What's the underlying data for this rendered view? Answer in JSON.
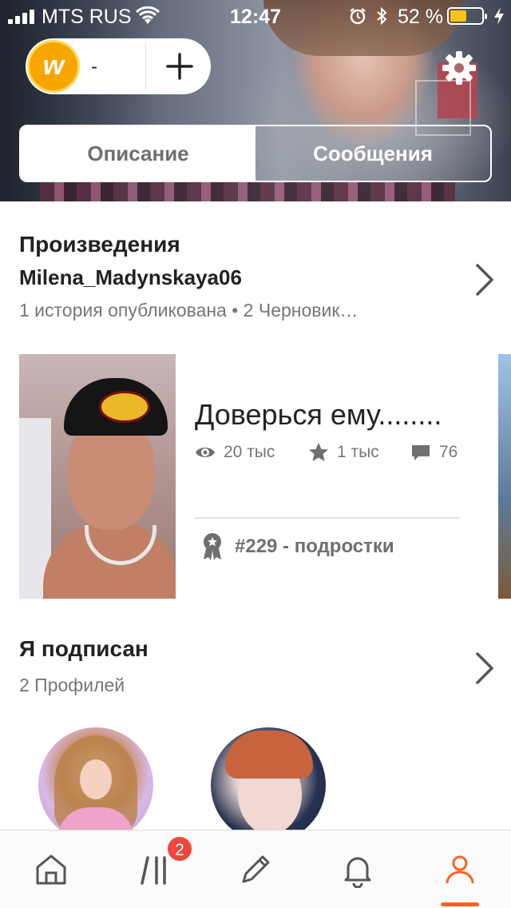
{
  "status_bar": {
    "carrier": "MTS RUS",
    "time": "12:47",
    "battery_percent_text": "52 %",
    "battery_level": 0.52
  },
  "header": {
    "coin_count": "-",
    "coin_letter": "w",
    "tabs": [
      {
        "label": "Описание",
        "active": true
      },
      {
        "label": "Сообщения",
        "active": false
      }
    ]
  },
  "works": {
    "title": "Произведения",
    "username": "Milena_Madynskaya06",
    "summary": "1 история опубликована • 2 Черновик…",
    "story": {
      "title": "Доверься ему........",
      "reads": "20 тыс",
      "votes": "1 тыс",
      "comments": "76",
      "rank_number": "#229",
      "rank_sep": " - ",
      "rank_tag": "подростки"
    }
  },
  "following": {
    "title": "Я подписан",
    "summary": "2 Профилей"
  },
  "tabbar": {
    "items": [
      "home-icon",
      "library-icon",
      "write-icon",
      "notifications-icon",
      "profile-icon"
    ],
    "library_badge": "2",
    "active_item": "profile",
    "accent_color": "#ff6122"
  },
  "colors": {
    "coin": "#f7a600",
    "badge": "#f0463c",
    "battery": "#f5c518"
  }
}
